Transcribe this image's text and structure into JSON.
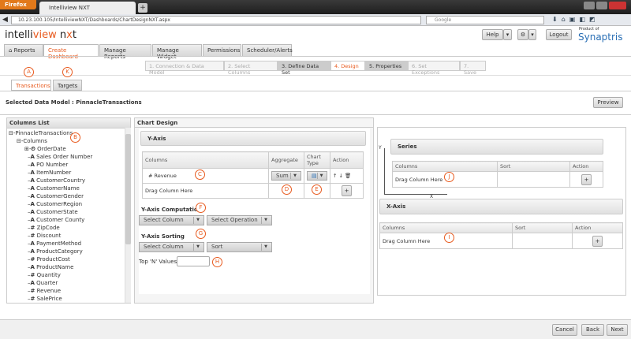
{
  "browser": {
    "menu": "Firefox",
    "tab_title": "Intelliview NXT",
    "new_tab": "+",
    "url": "10.23.100.105/IntelliviewNXT/Dashboards/ChartDesignNXT.aspx",
    "search_placeholder": "Google"
  },
  "header": {
    "logo_a": "intelli",
    "logo_b": "view",
    "logo_c": " n",
    "logo_d": "x",
    "logo_e": "t",
    "help": "Help",
    "settings": "⚙",
    "logout": "Logout",
    "brand_small": "Product of",
    "brand": "Synaptris"
  },
  "nav": {
    "tabs": [
      {
        "label": "⌂ Reports"
      },
      {
        "label": "Create Dashboard"
      },
      {
        "label": "Manage Reports"
      },
      {
        "label": "Manage Widget"
      },
      {
        "label": "Permissions"
      },
      {
        "label": "Scheduler/Alerts"
      }
    ]
  },
  "steps": [
    "1. Connection & Data Model",
    "2. Select Columns",
    "3. Define Data Set",
    "4. Design",
    "5. Properties",
    "6. Set Exceptions",
    "7. Save"
  ],
  "subtabs": [
    "Transactions",
    "Targets"
  ],
  "callouts": {
    "a": "A",
    "b": "B",
    "c": "C",
    "d": "D",
    "e": "E",
    "f": "F",
    "g": "G",
    "h": "H",
    "i": "I",
    "j": "J",
    "k": "K"
  },
  "selected_model": "Selected Data Model : PinnacleTransactions",
  "preview": "Preview",
  "columns_list": {
    "title": "Columns List",
    "root": "PinnacleTransactions",
    "folder": "Columns",
    "items": [
      {
        "icon": "⏲",
        "name": "OrderDate"
      },
      {
        "icon": "A",
        "name": "Sales Order Number"
      },
      {
        "icon": "A",
        "name": "PO Number"
      },
      {
        "icon": "A",
        "name": "ItemNumber"
      },
      {
        "icon": "A",
        "name": "CustomerCountry"
      },
      {
        "icon": "A",
        "name": "CustomerName"
      },
      {
        "icon": "A",
        "name": "CustomerGender"
      },
      {
        "icon": "A",
        "name": "CustomerRegion"
      },
      {
        "icon": "A",
        "name": "CustomerState"
      },
      {
        "icon": "A",
        "name": "Customer County"
      },
      {
        "icon": "#",
        "name": "ZipCode"
      },
      {
        "icon": "#",
        "name": "Discount"
      },
      {
        "icon": "A",
        "name": "PaymentMethod"
      },
      {
        "icon": "A",
        "name": "ProductCategory"
      },
      {
        "icon": "#",
        "name": "ProductCost"
      },
      {
        "icon": "A",
        "name": "ProductName"
      },
      {
        "icon": "#",
        "name": "Quantity"
      },
      {
        "icon": "A",
        "name": "Quarter"
      },
      {
        "icon": "#",
        "name": "Revenue"
      },
      {
        "icon": "#",
        "name": "SalePrice"
      }
    ]
  },
  "chart_design": {
    "title": "Chart Design",
    "yaxis": {
      "title": "Y-Axis",
      "headers": [
        "Columns",
        "Aggregate",
        "Chart Type",
        "Action"
      ],
      "row_column": "# Revenue",
      "aggregate": "Sum",
      "drag": "Drag Column Here",
      "add": "+",
      "actions": "↑ ↓ 🗑"
    },
    "computation": {
      "title": "Y-Axis Computation",
      "column": "Select Column",
      "operation": "Select Operation"
    },
    "sorting": {
      "title": "Y-Axis Sorting",
      "column": "Select Column",
      "sort": "Sort"
    },
    "topn": {
      "label": "Top 'N' Values",
      "value": ""
    }
  },
  "axes": {
    "y_letter": "Y",
    "x_letter": "X",
    "series": {
      "title": "Series",
      "headers": [
        "Columns",
        "Sort",
        "Action"
      ],
      "drag": "Drag Column Here",
      "add": "+"
    },
    "xaxis": {
      "title": "X-Axis",
      "headers": [
        "Columns",
        "Sort",
        "Action"
      ],
      "drag": "Drag Column Here",
      "add": "+"
    }
  },
  "footer": {
    "cancel": "Cancel",
    "back": "Back",
    "next": "Next"
  },
  "colors": {
    "accent": "#e85a1e"
  }
}
